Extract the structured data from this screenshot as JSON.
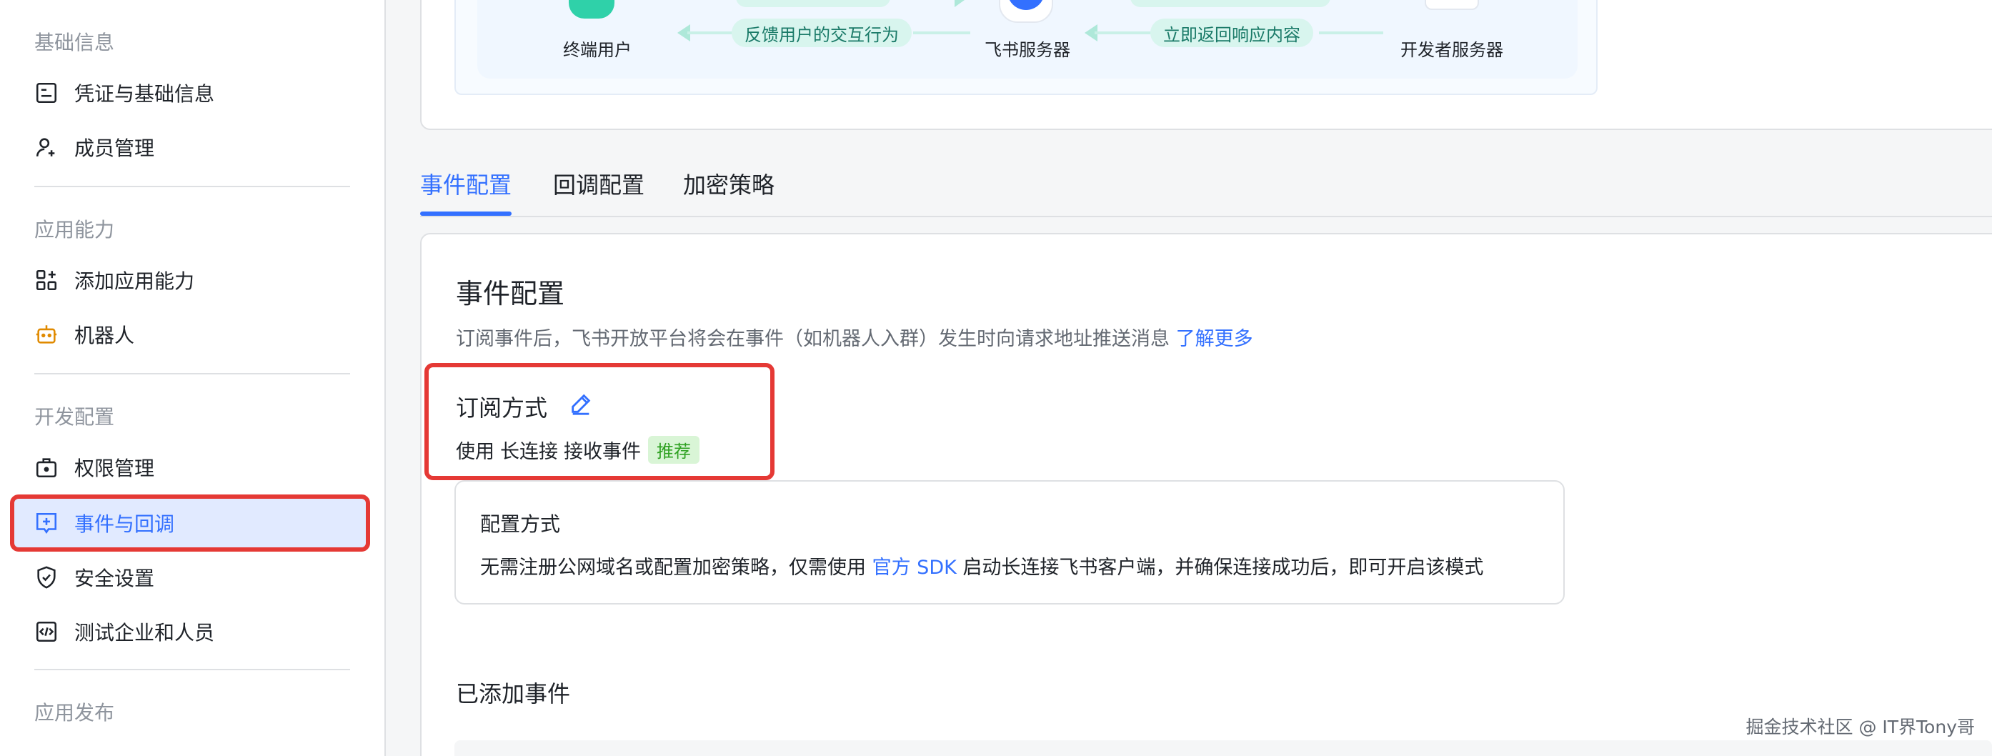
{
  "sidebar": {
    "groups": [
      "基础信息",
      "应用能力",
      "开发配置",
      "应用发布"
    ],
    "items": [
      {
        "label": "凭证与基础信息",
        "icon": "credential-icon"
      },
      {
        "label": "成员管理",
        "icon": "user-add-icon"
      },
      {
        "label": "添加应用能力",
        "icon": "apps-add-icon"
      },
      {
        "label": "机器人",
        "icon": "robot-icon"
      },
      {
        "label": "权限管理",
        "icon": "permission-icon"
      },
      {
        "label": "事件与回调",
        "icon": "event-icon",
        "active": true
      },
      {
        "label": "安全设置",
        "icon": "shield-icon"
      },
      {
        "label": "测试企业和人员",
        "icon": "code-icon"
      }
    ]
  },
  "flow": {
    "nodes": [
      "终端用户",
      "飞书服务器",
      "开发者服务器"
    ],
    "arrows": [
      "反馈用户的交互行为",
      "立即返回响应内容"
    ]
  },
  "tabs": [
    "事件配置",
    "回调配置",
    "加密策略"
  ],
  "event_config": {
    "title": "事件配置",
    "description": "订阅事件后，飞书开放平台将会在事件（如机器人入群）发生时向请求地址推送消息",
    "learn_more": "了解更多",
    "subscription": {
      "title": "订阅方式",
      "prefix": "使用",
      "method": "长连接",
      "suffix": "接收事件",
      "badge": "推荐"
    },
    "config": {
      "title": "配置方式",
      "text_before": "无需注册公网域名或配置加密策略，仅需使用",
      "link": "官方 SDK",
      "text_after": "启动长连接飞书客户端，并确保连接成功后，即可开启该模式"
    },
    "added_events_title": "已添加事件"
  },
  "watermark": "掘金技术社区 @ IT界Tony哥",
  "colors": {
    "accent": "#3370ff",
    "highlight_border": "#e53935",
    "badge_bg": "#d9f5d6",
    "badge_text": "#2ea121"
  }
}
